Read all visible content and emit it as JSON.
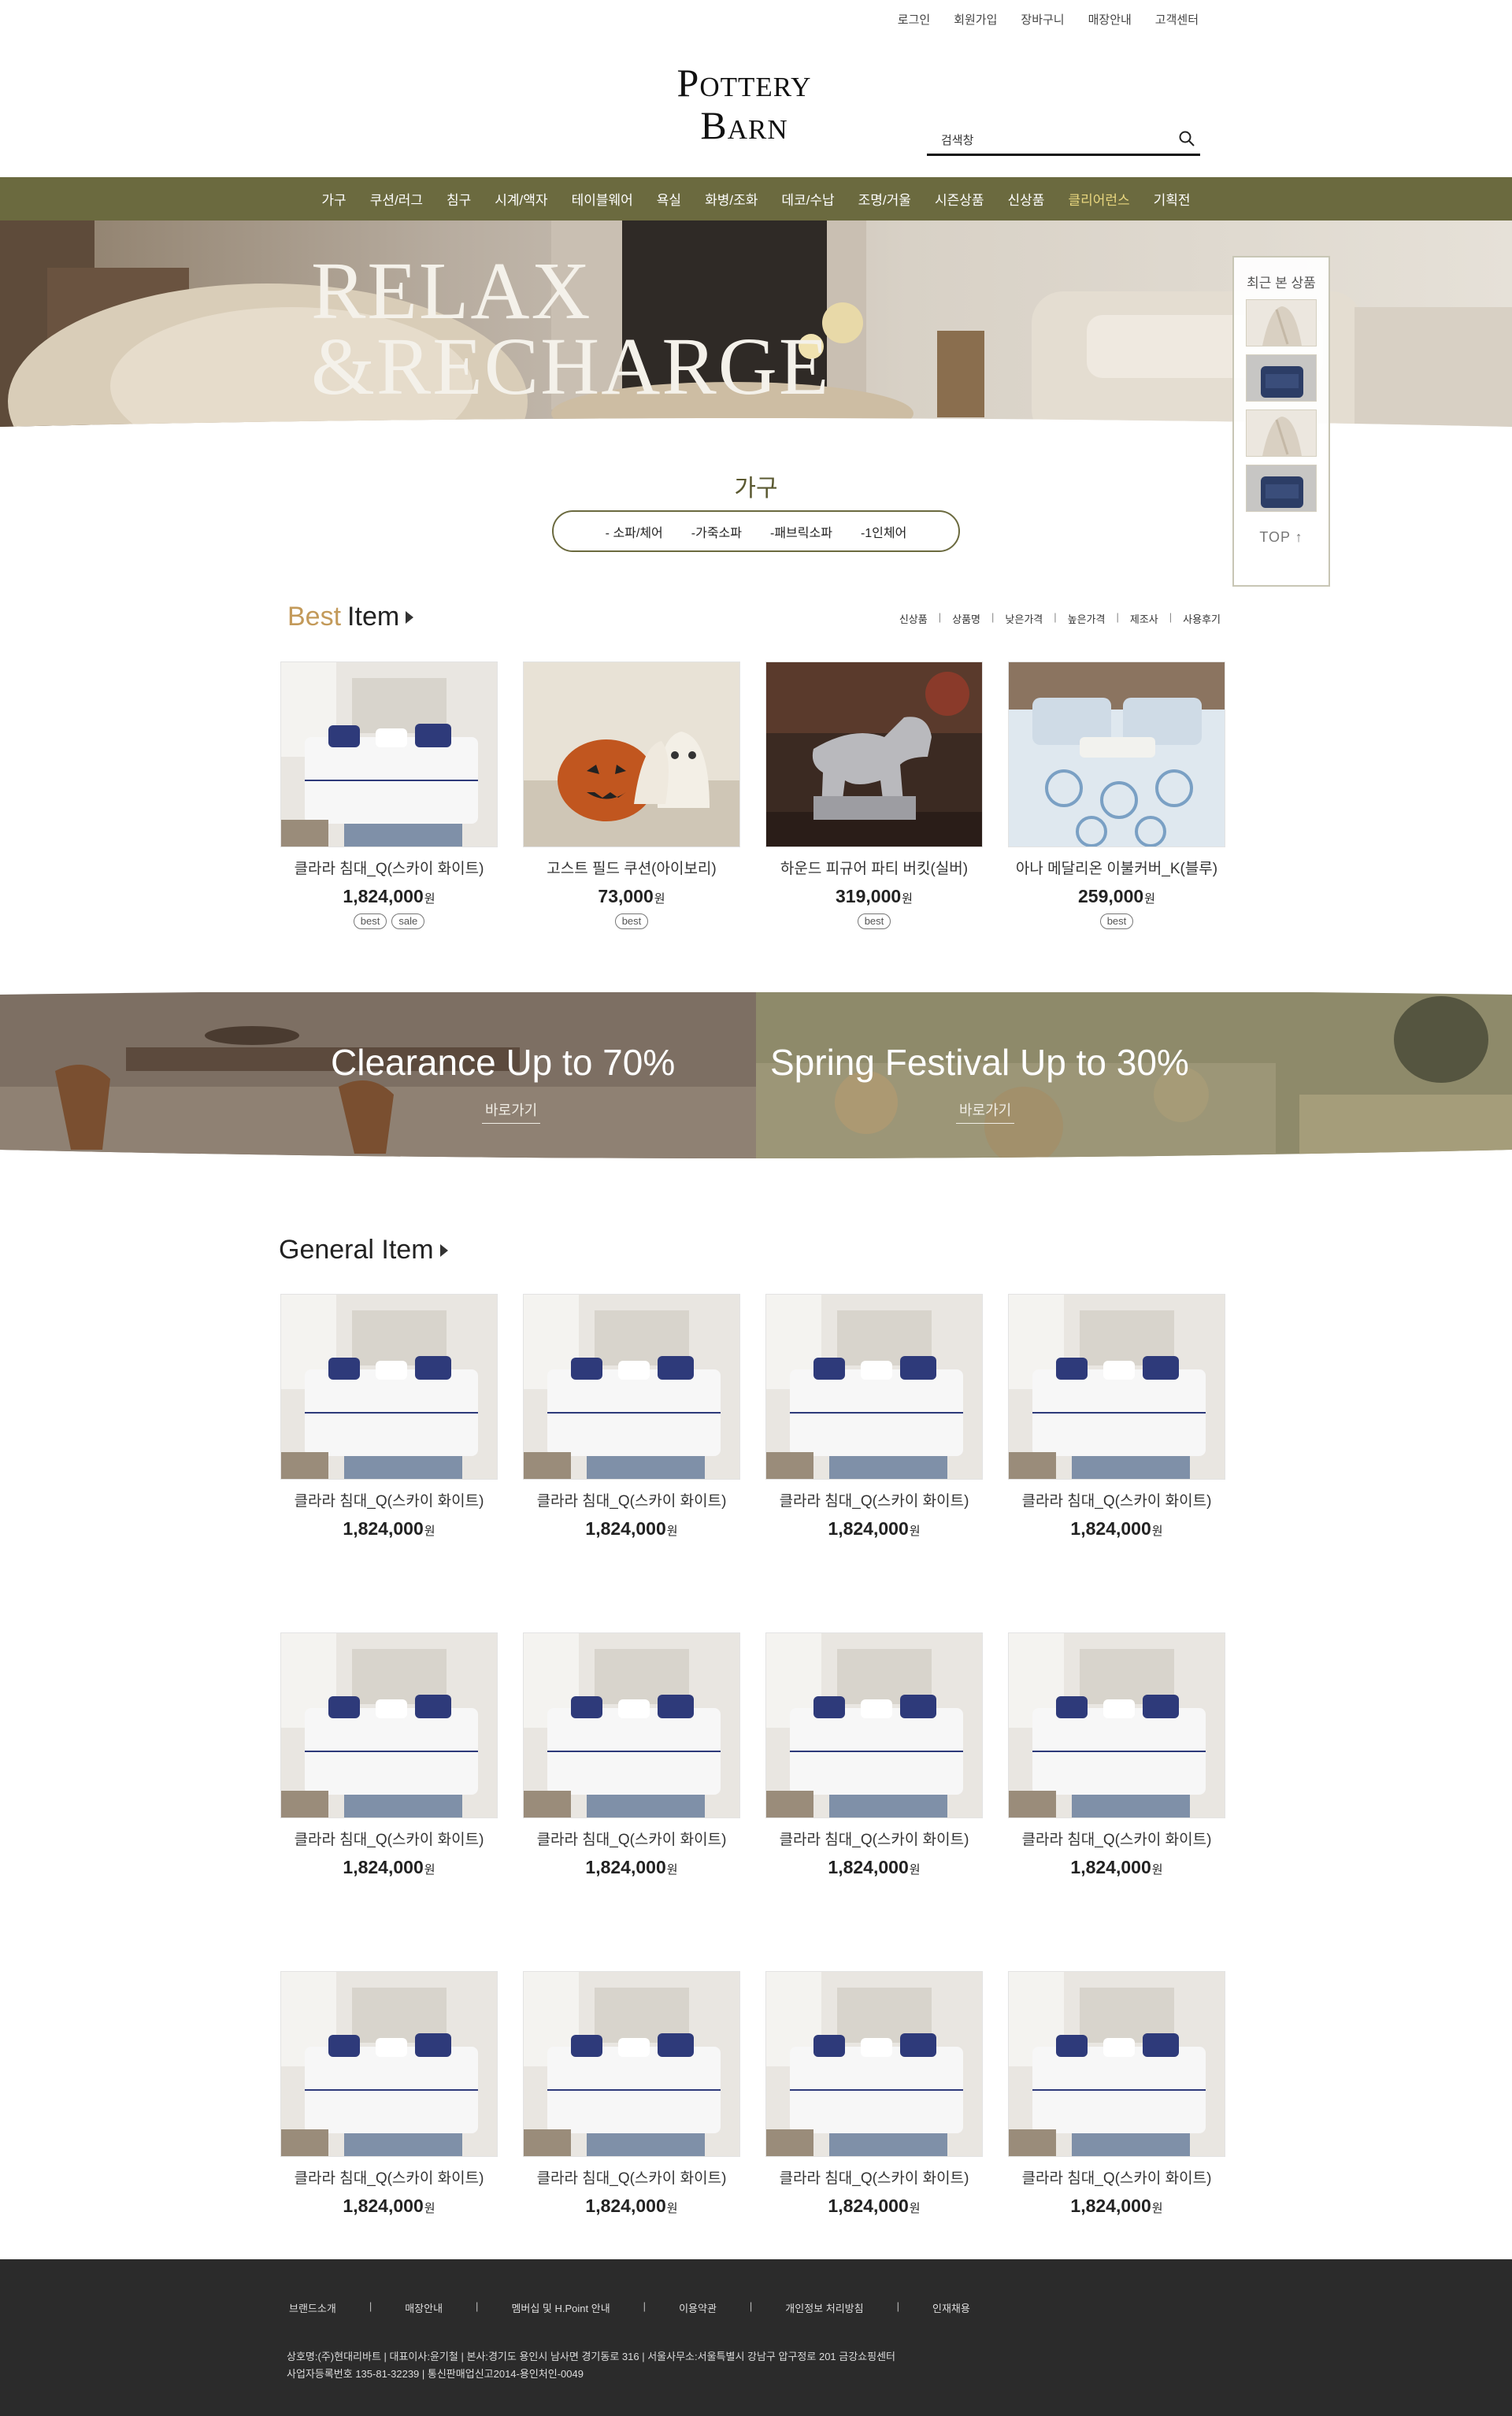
{
  "util": {
    "login": "로그인",
    "join": "회원가입",
    "cart": "장바구니",
    "stores": "매장안내",
    "cs": "고객센터"
  },
  "logo": {
    "line1": "Pottery",
    "line2": "Barn"
  },
  "search": {
    "placeholder": "검색창"
  },
  "nav": [
    "가구",
    "쿠션/러그",
    "침구",
    "시계/액자",
    "테이블웨어",
    "욕실",
    "화병/조화",
    "데코/수납",
    "조명/거울",
    "시즌상품",
    "신상품",
    "클리어런스",
    "기획전"
  ],
  "nav_highlight_color": "#e9d77f",
  "nav_bg_color": "#6b6a3f",
  "hero": {
    "line1": "RELAX",
    "line2": "&RECHARGE"
  },
  "recent": {
    "title": "최근 본 상품",
    "top_label": "TOP ↑"
  },
  "category": {
    "title": "가구",
    "subs": [
      "- 소파/체어",
      "-가죽소파",
      "-패브릭소파",
      "-1인체어"
    ]
  },
  "best": {
    "title_accent": "Best",
    "title_rest": "Item",
    "sort": [
      "신상품",
      "상품명",
      "낮은가격",
      "높은가격",
      "제조사",
      "사용후기"
    ],
    "items": [
      {
        "name": "클라라 침대_Q(스카이 화이트)",
        "price": "1,824,000",
        "won": "원",
        "badges": [
          "best",
          "sale"
        ],
        "icon": "bed-image"
      },
      {
        "name": "고스트 필드 쿠션(아이보리)",
        "price": "73,000",
        "won": "원",
        "badges": [
          "best"
        ],
        "icon": "pumpkin-cushion-image"
      },
      {
        "name": "하운드 피규어 파티 버킷(실버)",
        "price": "319,000",
        "won": "원",
        "badges": [
          "best"
        ],
        "icon": "dog-bucket-image"
      },
      {
        "name": "아나 메달리온 이불커버_K(블루)",
        "price": "259,000",
        "won": "원",
        "badges": [
          "best"
        ],
        "icon": "blue-bedding-image"
      }
    ]
  },
  "promo": {
    "left_title": "Clearance Up to 70%",
    "left_link": "바로가기",
    "right_title": "Spring Festival Up to 30%",
    "right_link": "바로가기"
  },
  "general": {
    "title": "General Item",
    "items": [
      {
        "name": "클라라 침대_Q(스카이 화이트)",
        "price": "1,824,000",
        "won": "원"
      },
      {
        "name": "클라라 침대_Q(스카이 화이트)",
        "price": "1,824,000",
        "won": "원"
      },
      {
        "name": "클라라 침대_Q(스카이 화이트)",
        "price": "1,824,000",
        "won": "원"
      },
      {
        "name": "클라라 침대_Q(스카이 화이트)",
        "price": "1,824,000",
        "won": "원"
      },
      {
        "name": "클라라 침대_Q(스카이 화이트)",
        "price": "1,824,000",
        "won": "원"
      },
      {
        "name": "클라라 침대_Q(스카이 화이트)",
        "price": "1,824,000",
        "won": "원"
      },
      {
        "name": "클라라 침대_Q(스카이 화이트)",
        "price": "1,824,000",
        "won": "원"
      },
      {
        "name": "클라라 침대_Q(스카이 화이트)",
        "price": "1,824,000",
        "won": "원"
      },
      {
        "name": "클라라 침대_Q(스카이 화이트)",
        "price": "1,824,000",
        "won": "원"
      },
      {
        "name": "클라라 침대_Q(스카이 화이트)",
        "price": "1,824,000",
        "won": "원"
      },
      {
        "name": "클라라 침대_Q(스카이 화이트)",
        "price": "1,824,000",
        "won": "원"
      },
      {
        "name": "클라라 침대_Q(스카이 화이트)",
        "price": "1,824,000",
        "won": "원"
      }
    ]
  },
  "footer": {
    "links": [
      "브랜드소개",
      "매장안내",
      "멤버십 및 H.Point 안내",
      "이용약관",
      "개인정보 처리방침",
      "인재채용"
    ],
    "separator": "|",
    "info1": "상호명:(주)현대리바트 | 대표이사:윤기철 | 본사:경기도 용인시 남사면 경기동로 316 | 서울사무소:서울특별시 강남구 압구정로 201 금강쇼핑센터",
    "info2": "사업자등록번호 135-81-32239 | 통신판매업신고2014-용인처인-0049"
  }
}
